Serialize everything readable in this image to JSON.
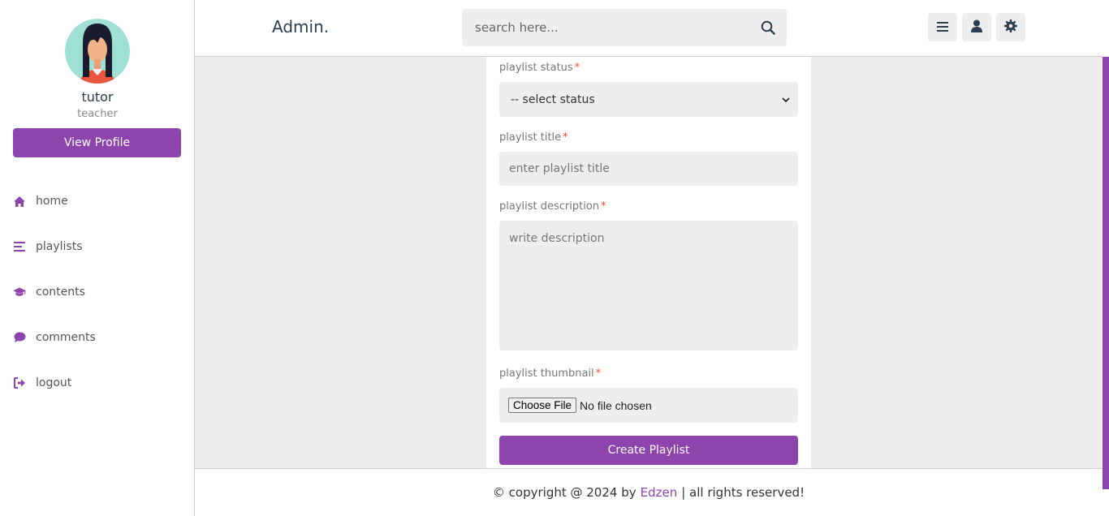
{
  "sidebar": {
    "profile": {
      "name": "tutor",
      "role": "teacher",
      "button": "View Profile"
    },
    "nav": [
      {
        "label": "home",
        "icon": "home-icon"
      },
      {
        "label": "playlists",
        "icon": "bars-icon"
      },
      {
        "label": "contents",
        "icon": "graduation-cap-icon"
      },
      {
        "label": "comments",
        "icon": "comment-icon"
      },
      {
        "label": "logout",
        "icon": "logout-icon"
      }
    ]
  },
  "header": {
    "logo": "Admin.",
    "search_placeholder": "search here...",
    "buttons": [
      "menu-icon",
      "user-icon",
      "settings-icon"
    ]
  },
  "form": {
    "status_label": "playlist status",
    "status_value": "-- select status",
    "title_label": "playlist title",
    "title_placeholder": "enter playlist title",
    "description_label": "playlist description",
    "description_placeholder": "write description",
    "thumbnail_label": "playlist thumbnail",
    "file_button": "Choose File",
    "file_status": "No file chosen",
    "submit": "Create Playlist",
    "required_mark": "*"
  },
  "footer": {
    "prefix": "© copyright @ 2024 by",
    "brand": "Edzen",
    "suffix": "| all rights reserved!"
  },
  "colors": {
    "accent": "#8e44ad",
    "background": "#eeeeee",
    "required": "#e74c3c"
  }
}
